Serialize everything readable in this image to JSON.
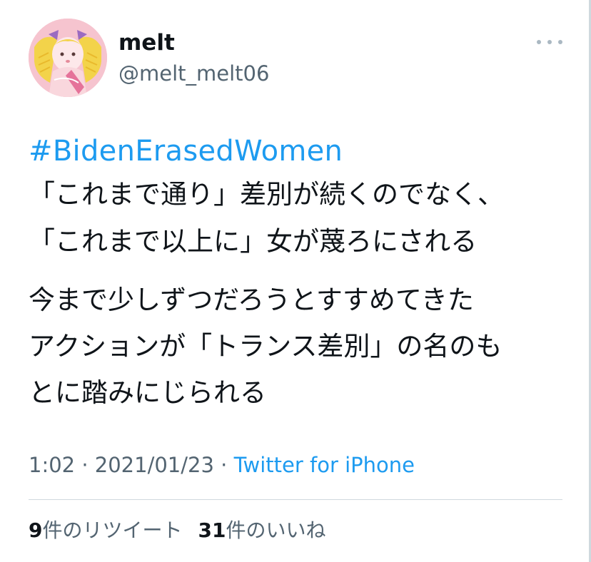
{
  "tweet": {
    "author": {
      "display_name": "melt",
      "handle": "@melt_melt06"
    },
    "hashtag": "#BidenErasedWomen",
    "lines": [
      "「これまで通り」差別が続くのでなく、",
      "「これまで以上に」女が蔑ろにされる",
      "今まで少しずつだろうとすすめてきた",
      "アクションが「トランス差別」の名のも",
      "とに踏みにじられる"
    ],
    "meta": {
      "time": "1:02",
      "separator": " · ",
      "date": "2021/01/23",
      "source": "Twitter for iPhone"
    },
    "stats": {
      "retweets_count": "9",
      "retweets_label": "件のリツイート",
      "likes_count": "31",
      "likes_label": "件のいいね"
    }
  },
  "icons": {
    "more": "more-horizontal-icon",
    "avatar": "profile-avatar"
  },
  "colors": {
    "link": "#1d9bf0",
    "secondary_text": "#536471",
    "divider": "#cfd9de"
  }
}
